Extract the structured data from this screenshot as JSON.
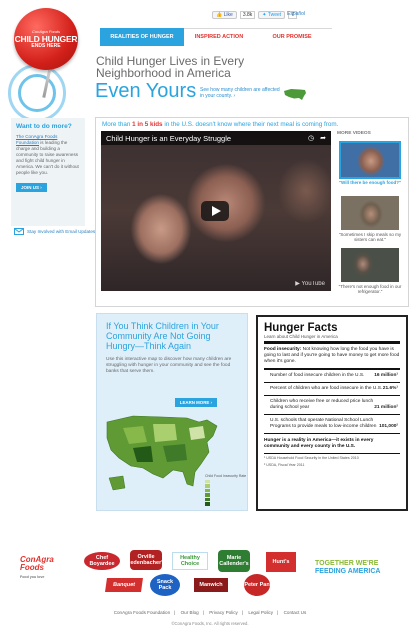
{
  "share": {
    "like_label": "Like",
    "like_count": "3.8k",
    "tweet_label": "Tweet",
    "tweet_count": "7",
    "espanol": "Español"
  },
  "nav": {
    "items": [
      "REALITIES OF HUNGER",
      "INSPIRED ACTION",
      "OUR PROMISE"
    ]
  },
  "logo": {
    "top": "ConAgra Foods",
    "main": "CHILD HUNGER",
    "sub": "ENDS HERE"
  },
  "hero": {
    "headline": "Child Hunger Lives in Every Neighborhood in America",
    "even": "Even Yours",
    "see_map": "See how many children are affected in your county. ›"
  },
  "sidebar": {
    "title": "Want to do more?",
    "link": "The ConAgra Foods Foundation",
    "text": "is leading the charge and building a community to raise awareness and fight child hunger in America. We can't do it without people like you.",
    "join": "JOIN US ›",
    "email": "Stay Involved with Email Updates"
  },
  "video": {
    "stat_pre": "More than",
    "stat_bold": "1 in 5 kids",
    "stat_post": "in the U.S. doesn't know where their next meal is coming from.",
    "title": "Child Hunger is an Everyday Struggle",
    "more_label": "MORE VIDEOS",
    "thumbs": [
      {
        "caption": "\"Will there be enough food?\"",
        "color": "#3f6fa5",
        "active": true
      },
      {
        "caption": "\"Sometimes I skip meals so my sisters can eat.\"",
        "color": "#7a7162",
        "active": false
      },
      {
        "caption": "\"There's not enough food in our refrigerator.\"",
        "color": "#4a5048",
        "active": false
      }
    ]
  },
  "map": {
    "title": "If You Think Children in Your Community Are Not Going Hungry—Think Again",
    "desc": "Use this interactive map to discover how many children are struggling with hunger in your community and see the food banks that serve them.",
    "learn": "LEARN MORE ›",
    "legend_title": "Child Food Insecurity Rate",
    "legend_colors": [
      "#cfe3a8",
      "#a9cf6e",
      "#86b84a",
      "#5f9a35",
      "#3f7a28",
      "#245a18"
    ]
  },
  "facts": {
    "title": "Hunger Facts",
    "subtitle": "Learn about Child Hunger in America",
    "insecurity_label": "Food insecurity:",
    "insecurity_text": "Not knowing how long the food you have is going to last and if you're going to have money to get more food when it's gone.",
    "rows": [
      {
        "label": "Number of food insecure children in the U.S.",
        "value": "16 million¹"
      },
      {
        "label": "Percent of children who are food insecure in the U.S.",
        "value": "21.6%¹"
      },
      {
        "label": "Children who receive free or reduced price lunch during school year",
        "value": "21 million²"
      },
      {
        "label": "U.S. schools that operate National School Lunch Programs to provide meals to low-income children",
        "value": "101,000²"
      }
    ],
    "note": "Hunger is a reality in America—it exists in every community and every county in the U.S.",
    "sources": [
      "¹ USDA Household Food Security in the United States 2010",
      "² USDA, Fiscal Year 2011"
    ]
  },
  "footer": {
    "conagra": "ConAgra Foods",
    "conagra_tag": "Food you love",
    "brands": [
      {
        "name": "Chef Boyardee",
        "color": "#c8282e"
      },
      {
        "name": "Orville Redenbacher's",
        "color": "#b22222"
      },
      {
        "name": "Healthy Choice",
        "color": "#ffffff"
      },
      {
        "name": "Marie Callender's",
        "color": "#2e7d32"
      },
      {
        "name": "Hunt's",
        "color": "#d32f2f"
      },
      {
        "name": "Banquet",
        "color": "#d32f2f"
      },
      {
        "name": "Snack Pack",
        "color": "#1e63c4"
      },
      {
        "name": "Manwich",
        "color": "#8b1a1a"
      },
      {
        "name": "Peter Pan",
        "color": "#c62828"
      }
    ],
    "together": "TOGETHER WE'RE",
    "feeding": "FEEDING AMERICA",
    "links": [
      "ConAgra Foods Foundation",
      "Our Blog",
      "Privacy Policy",
      "Legal Policy",
      "Contact Us"
    ],
    "copyright": "©ConAgra Foods, Inc. All rights reserved."
  }
}
